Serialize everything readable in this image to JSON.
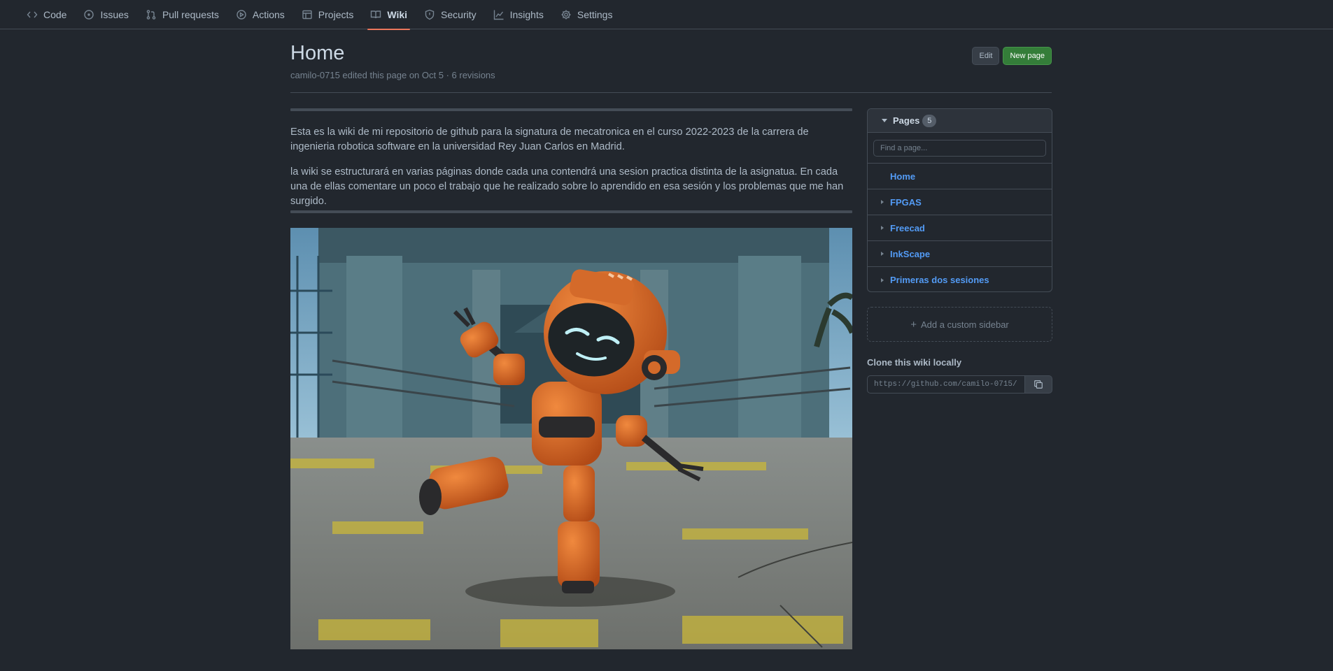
{
  "repo_nav": [
    {
      "label": "Code",
      "icon": "code-icon"
    },
    {
      "label": "Issues",
      "icon": "issue-icon"
    },
    {
      "label": "Pull requests",
      "icon": "pull-request-icon"
    },
    {
      "label": "Actions",
      "icon": "play-icon"
    },
    {
      "label": "Projects",
      "icon": "table-icon"
    },
    {
      "label": "Wiki",
      "icon": "book-icon",
      "selected": true
    },
    {
      "label": "Security",
      "icon": "shield-icon"
    },
    {
      "label": "Insights",
      "icon": "graph-icon"
    },
    {
      "label": "Settings",
      "icon": "gear-icon"
    }
  ],
  "page": {
    "title": "Home",
    "meta": "camilo-0715 edited this page on Oct 5 · 6 revisions",
    "edit_label": "Edit",
    "new_page_label": "New page"
  },
  "content": {
    "paragraphs": [
      "Esta es la wiki de mi repositorio de github para la signatura de mecatronica en el curso 2022-2023 de la carrera de ingenieria robotica software en la universidad Rey Juan Carlos en Madrid.",
      "la wiki se estructurará en varias páginas donde cada una contendrá una sesion practica distinta de la asignatua. En cada una de ellas comentare un poco el trabajo que he realizado sobre lo aprendido en esa sesión y los problemas que me han surgido."
    ]
  },
  "sidebar": {
    "pages_title": "Pages",
    "pages_count": "5",
    "find_placeholder": "Find a page...",
    "pages": [
      "Home",
      "FPGAS",
      "Freecad",
      "InkScape",
      "Primeras dos sesiones"
    ],
    "add_sidebar_label": "Add a custom sidebar",
    "clone_title": "Clone this wiki locally",
    "clone_url": "https://github.com/camilo-0715/"
  },
  "colors": {
    "background": "#22272e",
    "link": "#539bf5",
    "primary_button": "#347d39",
    "nav_underline": "#ec775c"
  }
}
